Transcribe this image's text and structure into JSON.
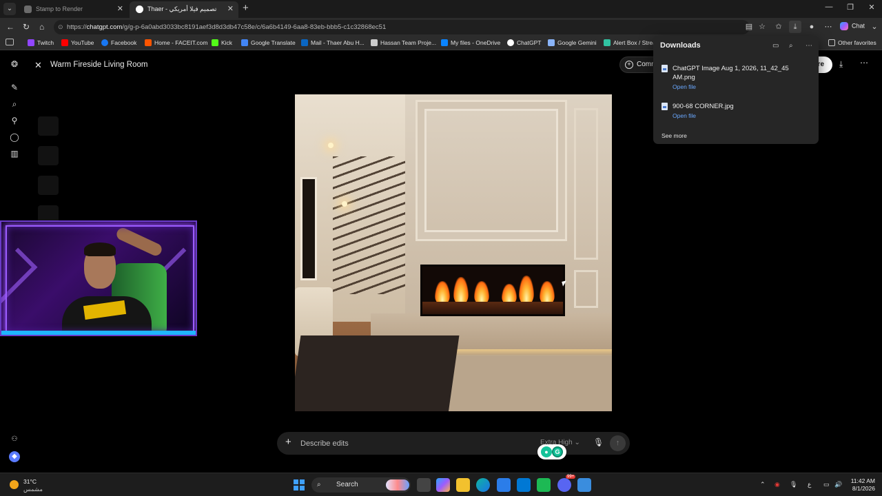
{
  "browser": {
    "tabs": [
      {
        "title": "Stamp to Render"
      },
      {
        "title": "Thaer - تصميم فيلا أمريكي"
      }
    ],
    "url_scheme": "https://",
    "url_host": "chatgpt.com",
    "url_path": "/g/g-p-6a0abd3033bc8191aef3d8d3db47c58e/c/6a6b4149-6aa8-83eb-bbb5-c1c32868ec51",
    "copilot_label": "Chat",
    "bookmarks": [
      {
        "label": "Twitch",
        "color": "#9146ff"
      },
      {
        "label": "YouTube",
        "color": "#ff0000"
      },
      {
        "label": "Facebook",
        "color": "#1877f2"
      },
      {
        "label": "Home - FACEIT.com",
        "color": "#ff5500"
      },
      {
        "label": "Kick",
        "color": "#53fc18"
      },
      {
        "label": "Google Translate",
        "color": "#4285f4"
      },
      {
        "label": "Mail - Thaer Abu H...",
        "color": "#0a66c2"
      },
      {
        "label": "Hassan Team Proje...",
        "color": "#cccccc"
      },
      {
        "label": "My files - OneDrive",
        "color": "#0a84ff"
      },
      {
        "label": "ChatGPT",
        "color": "#ffffff"
      },
      {
        "label": "Google Gemini",
        "color": "#8ab4f8"
      },
      {
        "label": "Alert Box / Strea",
        "color": "#31c3a2"
      }
    ],
    "other_favorites": "Other favorites"
  },
  "app": {
    "image_title": "Warm Fireside Living Room",
    "comment_label": "Comm",
    "share_label": "are",
    "prompt_placeholder": "Describe edits",
    "quality_label": "Extra High"
  },
  "downloads": {
    "title": "Downloads",
    "items": [
      {
        "name": "ChatGPT Image Aug 1, 2026, 11_42_45 AM.png",
        "action": "Open file"
      },
      {
        "name": "900-68 CORNER.jpg",
        "action": "Open file"
      }
    ],
    "see_more": "See more"
  },
  "taskbar": {
    "temperature": "31°C",
    "condition": "مشمس",
    "search_label": "Search",
    "keyboard_lang": "ع",
    "time": "11:42 AM",
    "date": "8/1/2026",
    "notification_badge": "99+"
  },
  "colors": {
    "accent_link": "#6aa8ff",
    "windows_blue": "#3fa0ff",
    "grammarly_green": "#15c39a"
  }
}
